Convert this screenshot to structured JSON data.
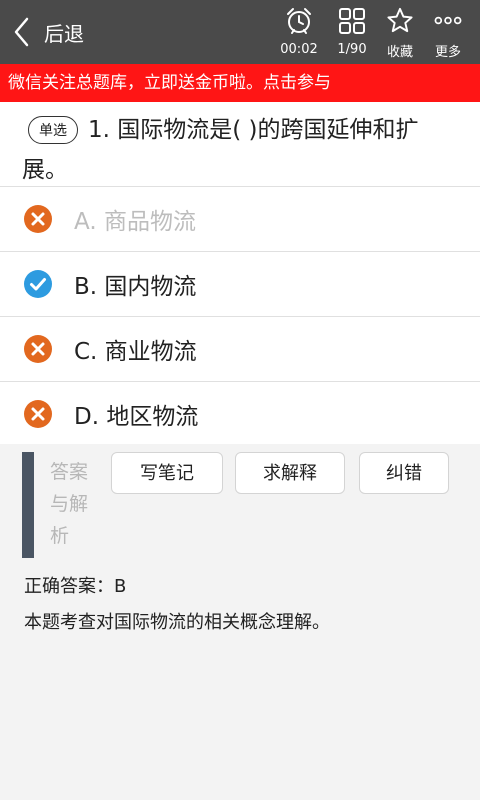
{
  "header": {
    "back_label": "后退",
    "timer": "00:02",
    "progress": "1/90",
    "favorite_label": "收藏",
    "more_label": "更多",
    "background_color": "#4a4a4a"
  },
  "banner": {
    "text": "微信关注总题库，立即送金币啦。点击参与",
    "color": "#ff1515"
  },
  "question": {
    "type_badge": "单选",
    "text": "1. 国际物流是( )的跨国延伸和扩展。"
  },
  "options": [
    {
      "label": "A. 商品物流",
      "icon": "wrong-icon",
      "state": "disabled"
    },
    {
      "label": "B. 国内物流",
      "icon": "correct-icon",
      "state": "correct"
    },
    {
      "label": "C. 商业物流",
      "icon": "wrong-icon",
      "state": "wrong"
    },
    {
      "label": "D. 地区物流",
      "icon": "wrong-icon",
      "state": "wrong"
    }
  ],
  "colors": {
    "wrong_icon": "#e2681f",
    "correct_icon": "#2d9be0",
    "analysis_bar": "#4a5563"
  },
  "analysis": {
    "title": "答案与解析",
    "write_note_label": "写笔记",
    "ask_explain_label": "求解释",
    "report_error_label": "纠错",
    "correct_answer": "正确答案：B",
    "explanation": "本题考查对国际物流的相关概念理解。"
  }
}
